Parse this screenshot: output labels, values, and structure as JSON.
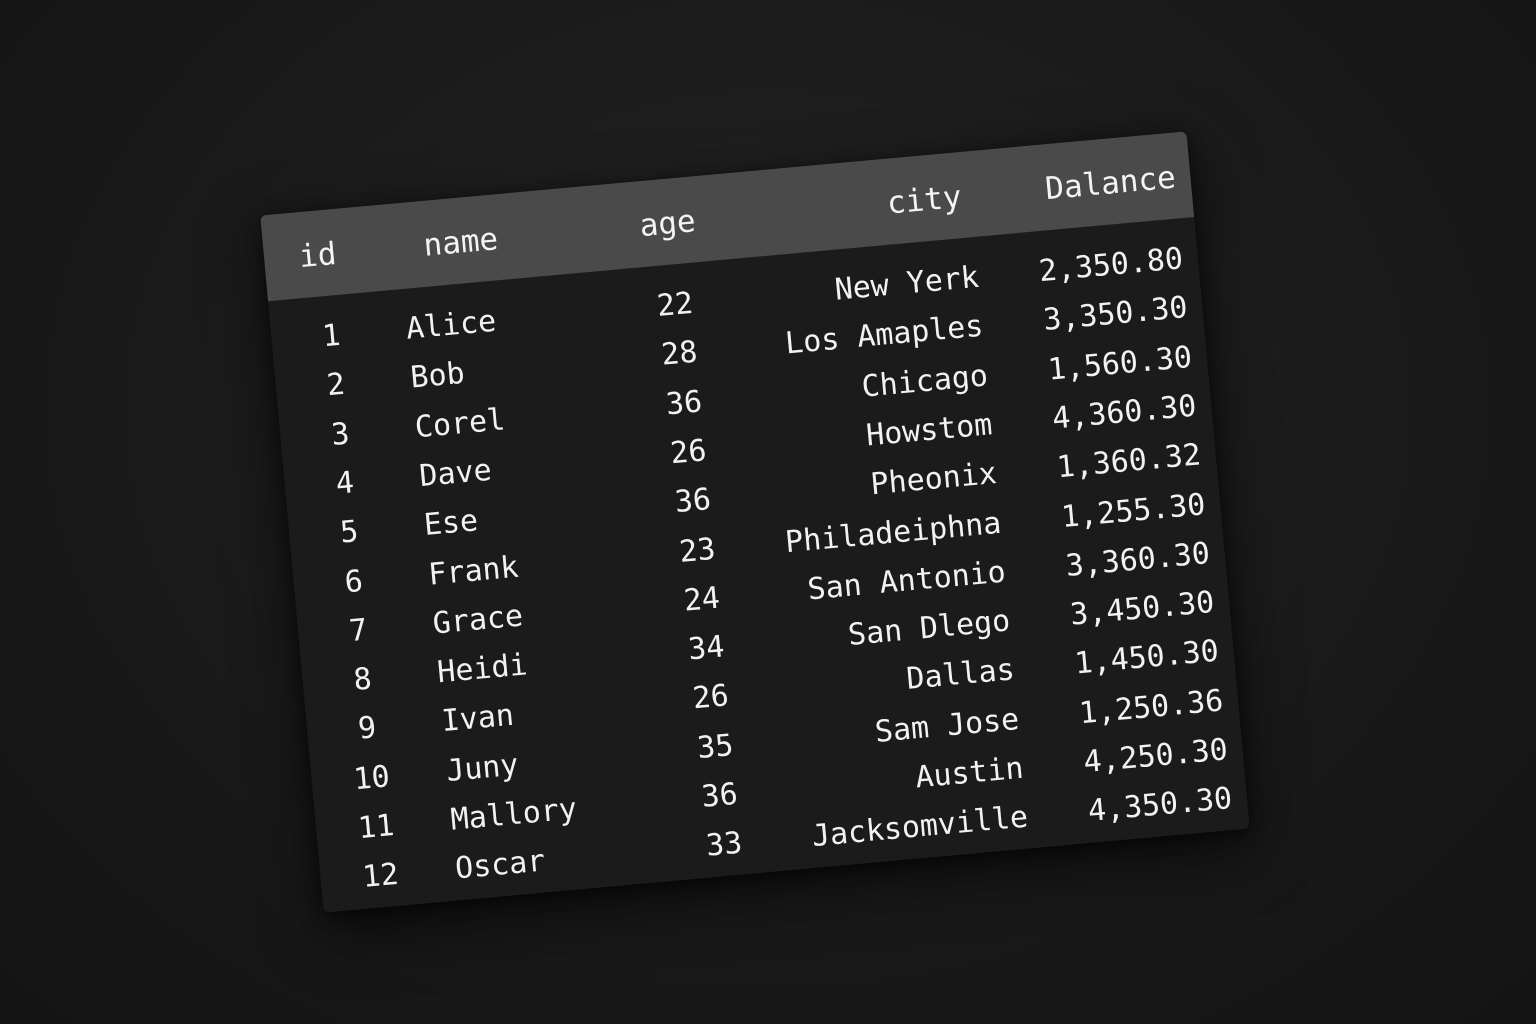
{
  "table": {
    "columns": [
      "id",
      "name",
      "age",
      "city",
      "Dalance"
    ],
    "rows": [
      [
        "1",
        "Alice",
        "22",
        "New Yerk",
        "2,350.80"
      ],
      [
        "2",
        "Bob",
        "28",
        "Los Amaples",
        "3,350.30"
      ],
      [
        "3",
        "Corel",
        "36",
        "Chicago",
        "1,560.30"
      ],
      [
        "4",
        "Dave",
        "26",
        "Howstom",
        "4,360.30"
      ],
      [
        "5",
        "Ese",
        "36",
        "Pheonix",
        "1,360.32"
      ],
      [
        "6",
        "Frank",
        "23",
        "Philadeiphna",
        "1,255.30"
      ],
      [
        "7",
        "Grace",
        "24",
        "San Antonio",
        "3,360.30"
      ],
      [
        "8",
        "Heidi",
        "34",
        "San Dlego",
        "3,450.30"
      ],
      [
        "9",
        "Ivan",
        "26",
        "Dallas",
        "1,450.30"
      ],
      [
        "10",
        "Juny",
        "35",
        "Sam Jose",
        "1,250.36"
      ],
      [
        "11",
        "Mallory",
        "36",
        "Austin",
        "4,250.30"
      ],
      [
        "12",
        "Oscar",
        "33",
        "Jacksomville",
        "4,350.30"
      ]
    ]
  }
}
